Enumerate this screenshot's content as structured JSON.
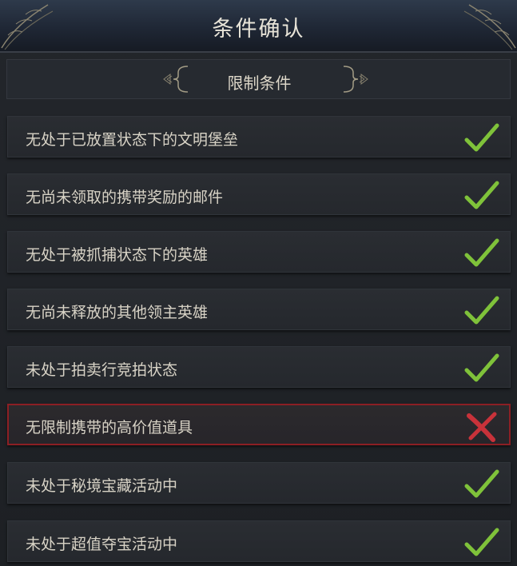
{
  "dialog": {
    "title": "条件确认",
    "subheader": "限制条件"
  },
  "colors": {
    "pass": "#7fc23a",
    "fail": "#c8323a",
    "fail_border": "#8c1f24"
  },
  "conditions": [
    {
      "label": "无处于已放置状态下的文明堡垒",
      "status": "pass",
      "icon": "check-icon"
    },
    {
      "label": "无尚未领取的携带奖励的邮件",
      "status": "pass",
      "icon": "check-icon"
    },
    {
      "label": "无处于被抓捕状态下的英雄",
      "status": "pass",
      "icon": "check-icon"
    },
    {
      "label": "无尚未释放的其他领主英雄",
      "status": "pass",
      "icon": "check-icon"
    },
    {
      "label": "未处于拍卖行竞拍状态",
      "status": "pass",
      "icon": "check-icon"
    },
    {
      "label": "无限制携带的高价值道具",
      "status": "fail",
      "icon": "cross-icon"
    },
    {
      "label": "未处于秘境宝藏活动中",
      "status": "pass",
      "icon": "check-icon"
    },
    {
      "label": "未处于超值夺宝活动中",
      "status": "pass",
      "icon": "check-icon"
    }
  ]
}
